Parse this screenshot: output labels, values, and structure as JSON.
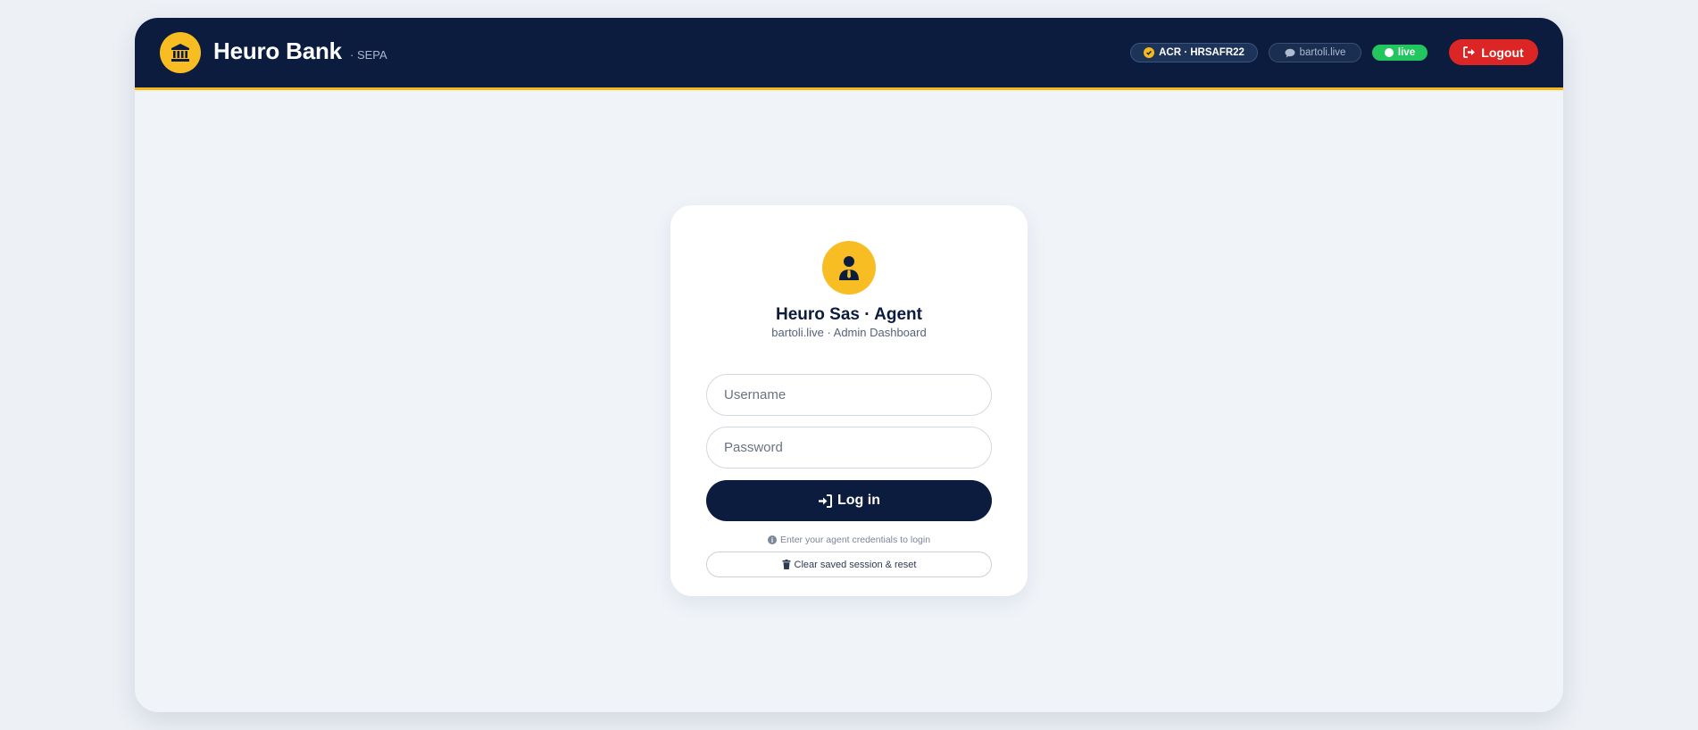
{
  "header": {
    "brand_name": "Heuro Bank",
    "brand_sub": "· SEPA",
    "acr_badge": "ACR · HRSAFR22",
    "domain_badge": "bartoli.live",
    "status_badge": "live",
    "logout_label": "Logout"
  },
  "login": {
    "title": "Heuro Sas · Agent",
    "subtitle": "bartoli.live · Admin Dashboard",
    "username_placeholder": "Username",
    "password_placeholder": "Password",
    "login_label": "Log in",
    "hint": "Enter your agent credentials to login",
    "reset_label": "Clear saved session & reset"
  },
  "icons": {
    "brand": "bank-icon",
    "acr": "check-circle-icon",
    "domain": "comment-icon",
    "status": "dot-icon",
    "logout": "sign-out-icon",
    "avatar": "user-tie-icon",
    "login": "sign-in-icon",
    "hint": "info-circle-icon",
    "reset": "trash-icon"
  },
  "colors": {
    "navy": "#0b1c3e",
    "gold": "#f8bd23",
    "danger": "#dc2626",
    "success": "#22c55e",
    "background": "#f0f4f9"
  }
}
